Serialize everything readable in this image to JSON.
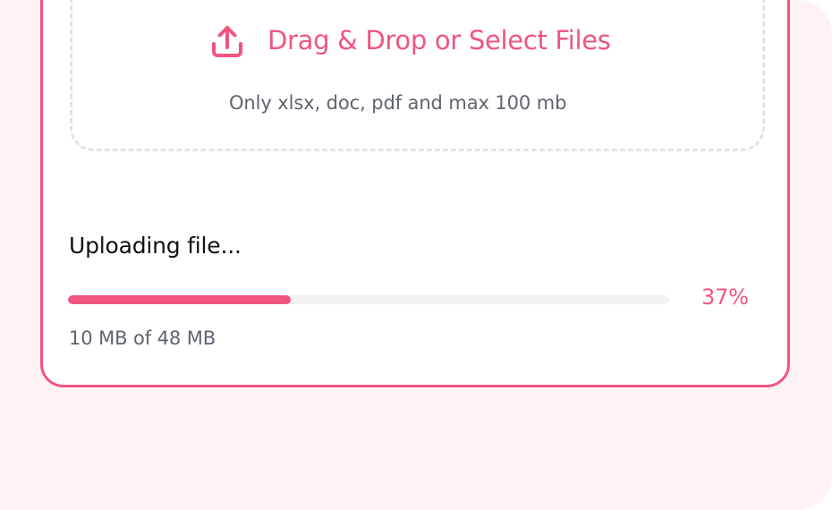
{
  "colors": {
    "accent": "#f0557f",
    "background": "#fff2f5",
    "card": "#ffffff",
    "text_primary": "#111111",
    "text_secondary": "#5f6470",
    "progress_track": "#f2f2f4",
    "dropzone_border": "#e3e3e6"
  },
  "dropzone": {
    "icon": "upload-icon",
    "title": "Drag & Drop or Select Files",
    "hint": "Only xlsx, doc, pdf and max 100 mb"
  },
  "upload_status": {
    "title": "Uploading file...",
    "progress_percent_label": "37%",
    "progress_value": 0.37,
    "size_label": "10 MB of 48 MB"
  }
}
